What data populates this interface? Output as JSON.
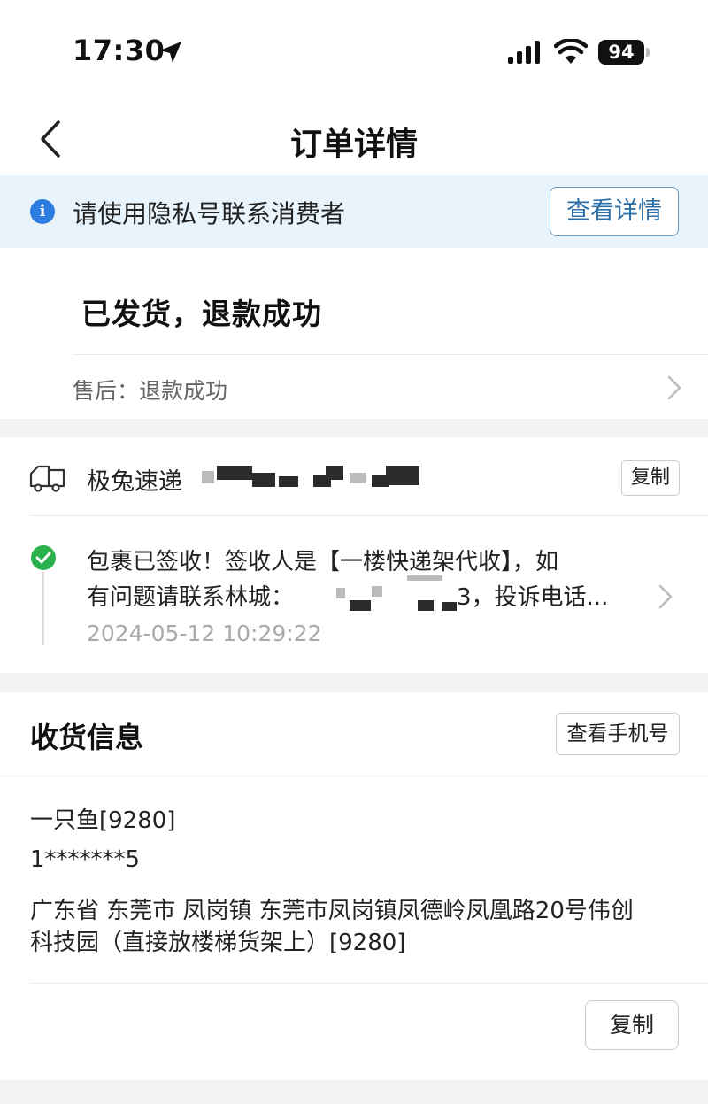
{
  "status_bar": {
    "time": "17:30",
    "battery": "94"
  },
  "nav": {
    "title": "订单详情"
  },
  "notice": {
    "text": "请使用隐私号联系消费者",
    "button": "查看详情"
  },
  "order_status": {
    "title": "已发货，退款成功",
    "aftersale": "售后：退款成功"
  },
  "logistics": {
    "carrier": "极兔速递",
    "copy_button": "复制",
    "track_line1": "包裹已签收！签收人是【一楼快递架代收】，如",
    "track_line2_prefix": "有问题请联系林城：",
    "track_line2_suffix": "3，投诉电话...",
    "track_time": "2024-05-12 10:29:22"
  },
  "receiver": {
    "section_title": "收货信息",
    "view_phone_button": "查看手机号",
    "name": "一只鱼[9280]",
    "phone": "1*******5",
    "address_line1": "广东省 东莞市 凤岗镇 东莞市凤岗镇凤德岭凤凰路20号伟创",
    "address_line2": "科技园（直接放楼梯货架上）[9280]",
    "copy_button": "复制"
  },
  "colors": {
    "accent_blue": "#2f7ce0",
    "notice_bg": "#e8f3fb",
    "success_green": "#2bb24c"
  }
}
